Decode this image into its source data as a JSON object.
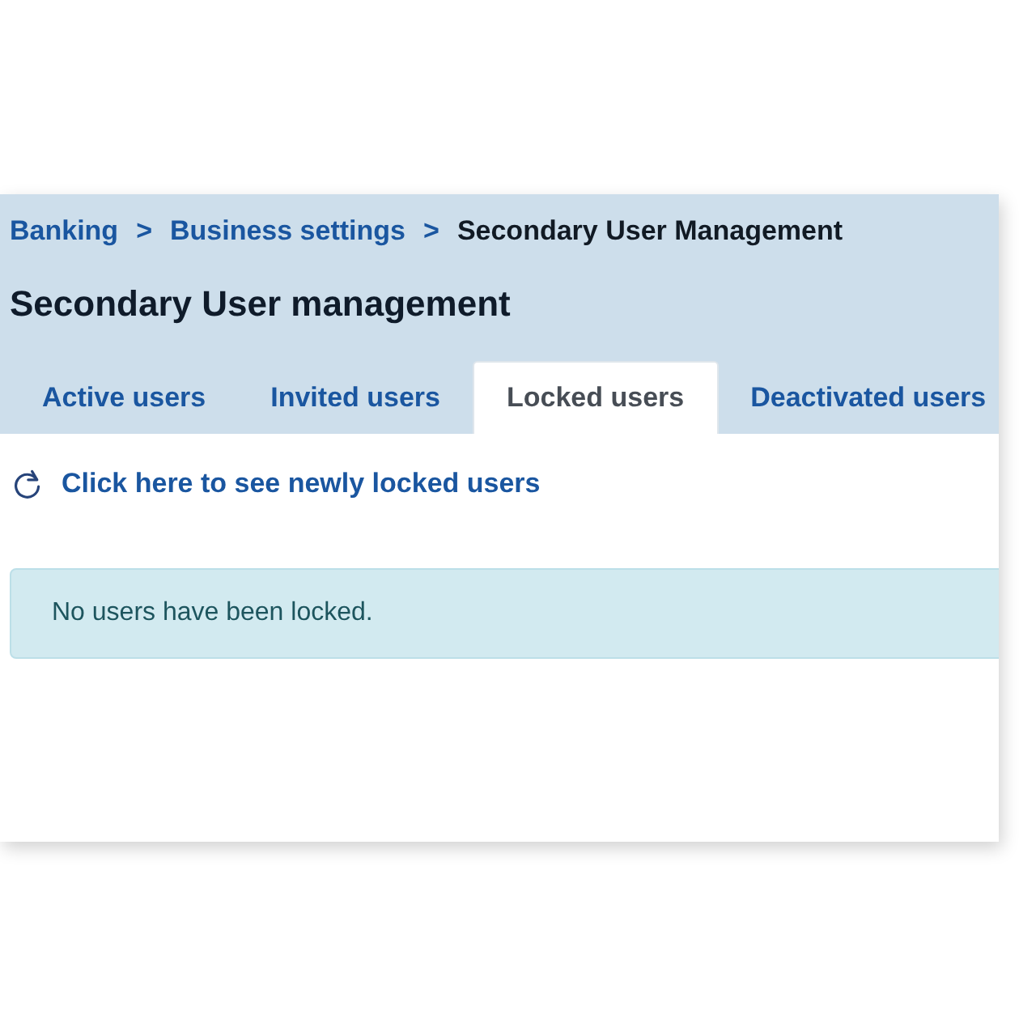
{
  "breadcrumb": [
    {
      "label": "Banking",
      "kind": "link"
    },
    {
      "label": ">",
      "kind": "separator"
    },
    {
      "label": "Business settings",
      "kind": "link"
    },
    {
      "label": ">",
      "kind": "separator"
    },
    {
      "label": "Secondary User Management",
      "kind": "current"
    }
  ],
  "title": "Secondary User management",
  "tabs": [
    {
      "label": "Active users",
      "selected": false
    },
    {
      "label": "Invited users",
      "selected": false
    },
    {
      "label": "Locked users",
      "selected": true
    },
    {
      "label": "Deactivated users",
      "selected": false
    }
  ],
  "refresh_link": {
    "label": "Click here to see newly locked users"
  },
  "alert": {
    "text": "No users have been locked."
  }
}
